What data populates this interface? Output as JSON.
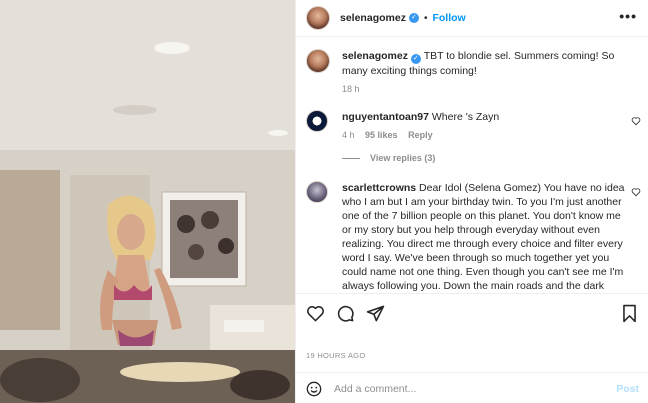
{
  "post": {
    "author": "selenagomez",
    "follow_label": "Follow",
    "dot": "•",
    "more_label": "•••"
  },
  "caption": {
    "username": "selenagomez",
    "text": "TBT to blondie sel. Summers coming! So many exciting things coming!",
    "time": "18 h"
  },
  "comments": [
    {
      "username": "nguyentantoan97",
      "text": "Where 's Zayn",
      "time": "4 h",
      "likes": "95 likes",
      "reply_label": "Reply",
      "view_replies": "View replies (3)"
    },
    {
      "username": "scarlettcrowns",
      "text": "Dear Idol (Selena Gomez) You have no idea who I am but I am your birthday twin. To you I'm just another one of the 7 billion people on this planet. You don't know me or my story but you help through everyday without even realizing. You direct me through every choice and filter every word I say. We've been through so much together yet you could name not one thing. Even though you can't see me I'm always following you. Down the main roads and the dark alleyways. You are my inspiration"
    }
  ],
  "footer": {
    "time_ago": "19 HOURS AGO",
    "comment_placeholder": "Add a comment...",
    "post_label": "Post"
  },
  "icons": {
    "verified": "verified-badge-icon",
    "like": "heart-icon",
    "comment": "comment-bubble-icon",
    "share": "paper-plane-icon",
    "save": "bookmark-icon",
    "emoji": "smiley-icon"
  },
  "colors": {
    "link": "#0095f6",
    "verified": "#3897f0",
    "muted": "#8e8e8e",
    "post_disabled": "#b2dffc"
  }
}
